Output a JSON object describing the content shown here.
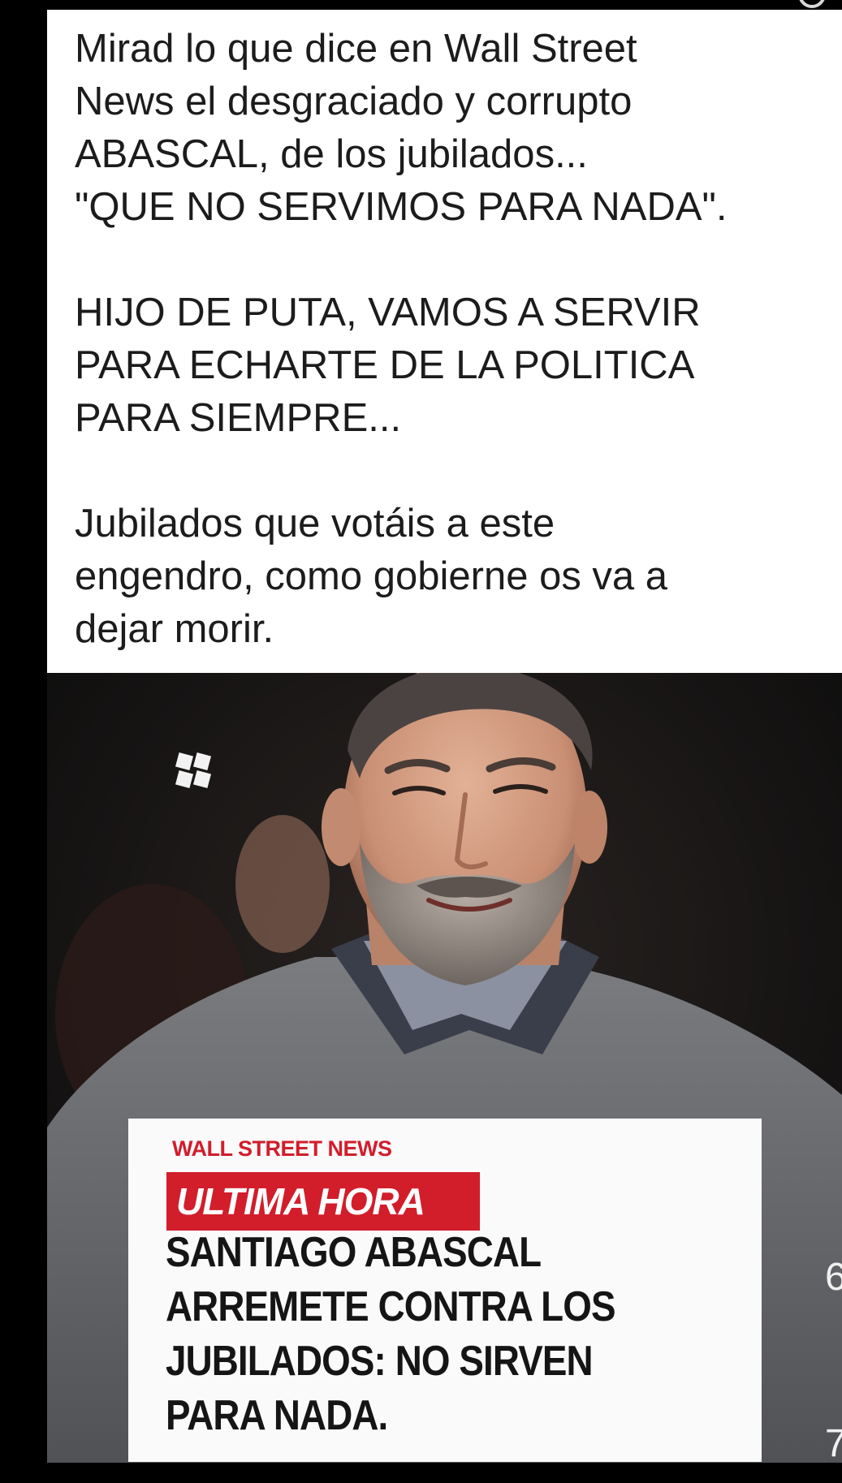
{
  "post": {
    "paragraphs": [
      "Mirad lo que dice en Wall Street\nNews el desgraciado y corrupto\nABASCAL,  de los jubilados...\n\"QUE NO SERVIMOS PARA NADA\".",
      "HIJO DE PUTA, VAMOS A SERVIR\nPARA ECHARTE DE LA POLITICA\nPARA SIEMPRE...",
      "Jubilados que votáis a este\nengendro, como gobierne os va a\ndejar morir."
    ]
  },
  "news_graphic": {
    "source": "WALL STREET NEWS",
    "tag": "ULTIMA HORA",
    "headline": "SANTIAGO ABASCAL\nARREMETE CONTRA LOS\nJUBILADOS: NO SIRVEN\nPARA NADA.",
    "tag_color": "#d21d2b"
  },
  "right_edge_fragments": {
    "frag_1": "6",
    "frag_2": "7"
  },
  "icons": {
    "corner": "search-icon",
    "photo_mark": "logo-icon"
  }
}
